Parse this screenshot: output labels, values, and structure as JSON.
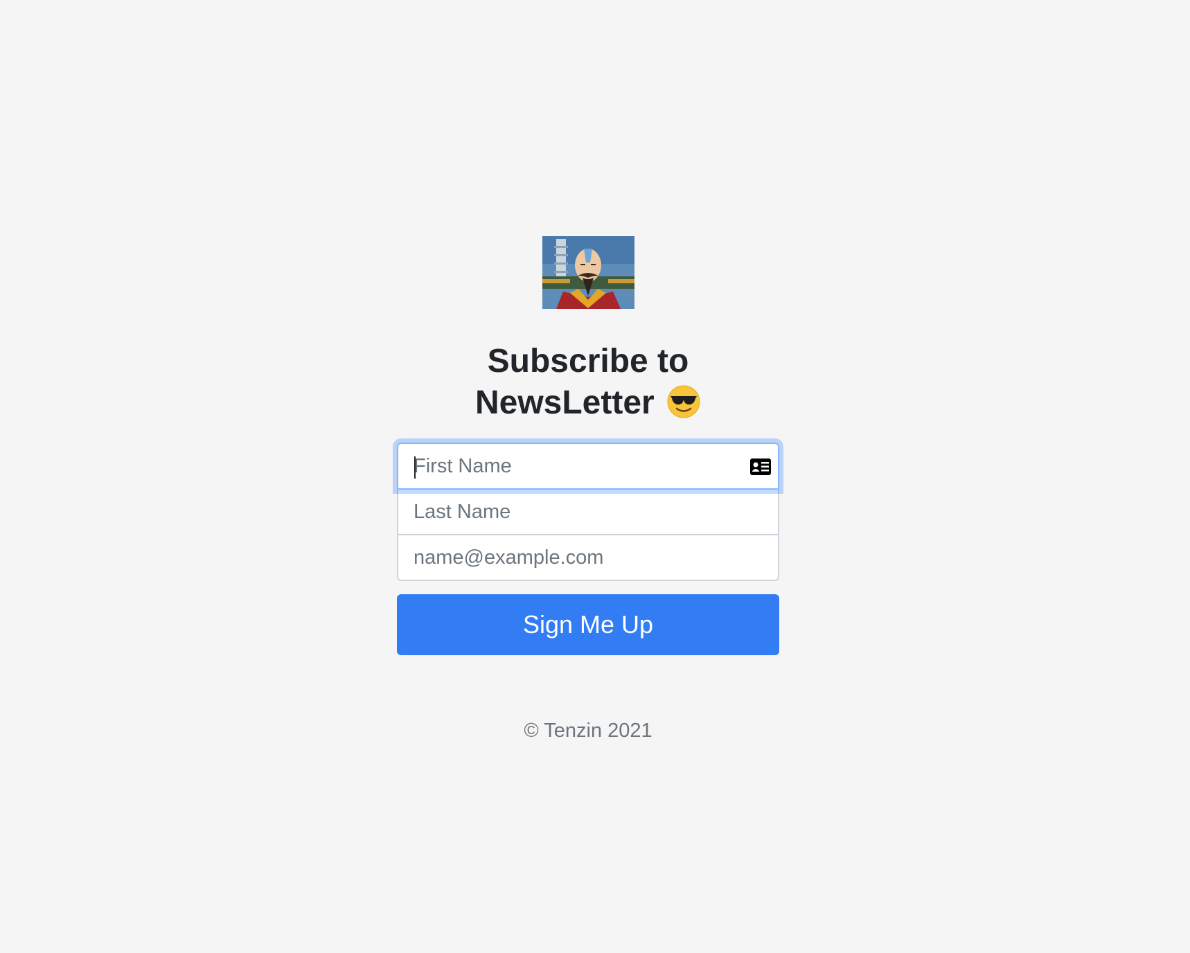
{
  "logo": {
    "alt": "Tenzin avatar"
  },
  "heading": {
    "line1": "Subscribe to",
    "line2": "NewsLetter",
    "emoji_name": "smiling-face-with-sunglasses-icon"
  },
  "form": {
    "first_name_placeholder": "First Name",
    "last_name_placeholder": "Last Name",
    "email_placeholder": "name@example.com",
    "submit_label": "Sign Me Up"
  },
  "footer": {
    "copyright": "© Tenzin 2021"
  },
  "colors": {
    "background": "#f5f5f5",
    "primary_button": "#337df4",
    "focus_ring": "#86b7fe",
    "heading_text": "#212529",
    "muted_text": "#6c757d"
  }
}
